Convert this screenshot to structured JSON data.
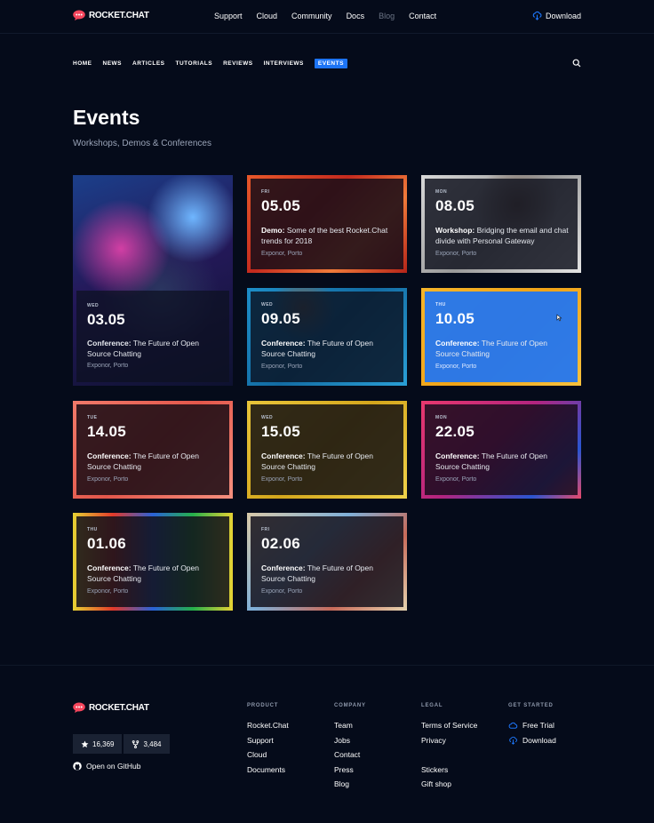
{
  "brand": {
    "name": "ROCKET.CHAT",
    "color": "#f5455c"
  },
  "accent": "#1d74f5",
  "header": {
    "nav": [
      "Support",
      "Cloud",
      "Community",
      "Docs",
      "Blog",
      "Contact"
    ],
    "download_label": "Download"
  },
  "subnav": {
    "items": [
      "HOME",
      "NEWS",
      "ARTICLES",
      "TUTORIALS",
      "REVIEWS",
      "INTERVIEWS",
      "EVENTS"
    ],
    "active": "EVENTS"
  },
  "page": {
    "title": "Events",
    "subtitle": "Workshops, Demos & Conferences"
  },
  "events": [
    {
      "day": "WED",
      "date": "03.05",
      "type": "Conference:",
      "text": " The Future of Open Source Chatting",
      "location": "Exponor, Porto"
    },
    {
      "day": "FRI",
      "date": "05.05",
      "type": "Demo:",
      "text": " Some of the best Rocket.Chat trends for 2018",
      "location": "Exponor, Porto"
    },
    {
      "day": "MON",
      "date": "08.05",
      "type": "Workshop:",
      "text": " Bridging the email and chat divide with Personal Gateway",
      "location": "Exponor, Porto"
    },
    {
      "day": "WED",
      "date": "09.05",
      "type": "Conference:",
      "text": " The Future of Open Source Chatting",
      "location": "Exponor, Porto"
    },
    {
      "day": "THU",
      "date": "10.05",
      "type": "Conference:",
      "text": " The Future of Open Source Chatting",
      "location": "Exponor, Porto"
    },
    {
      "day": "TUE",
      "date": "14.05",
      "type": "Conference:",
      "text": " The Future of Open Source Chatting",
      "location": "Exponor, Porto"
    },
    {
      "day": "WED",
      "date": "15.05",
      "type": "Conference:",
      "text": " The Future of Open Source Chatting",
      "location": "Exponor, Porto"
    },
    {
      "day": "MON",
      "date": "22.05",
      "type": "Conference:",
      "text": " The Future of Open Source Chatting",
      "location": "Exponor, Porto"
    },
    {
      "day": "THU",
      "date": "01.06",
      "type": "Conference:",
      "text": " The Future of Open Source Chatting",
      "location": "Exponor, Porto"
    },
    {
      "day": "FRI",
      "date": "02.06",
      "type": "Conference:",
      "text": " The Future of Open Source Chatting",
      "location": "Exponor, Porto"
    }
  ],
  "footer": {
    "stars": "16,369",
    "forks": "3,484",
    "github_label": "Open on GitHub",
    "columns": {
      "product": {
        "title": "PRODUCT",
        "links": [
          "Rocket.Chat",
          "Support",
          "Cloud",
          "Documents"
        ]
      },
      "company": {
        "title": "COMPANY",
        "links": [
          "Team",
          "Jobs",
          "Contact",
          "Press",
          "Blog"
        ]
      },
      "legal": {
        "title": "LEGAL",
        "links": [
          "Terms of Service",
          "Privacy",
          "Stickers",
          "Gift shop"
        ]
      },
      "get_started": {
        "title": "GET STARTED",
        "links": [
          "Free Trial",
          "Download"
        ]
      }
    }
  }
}
